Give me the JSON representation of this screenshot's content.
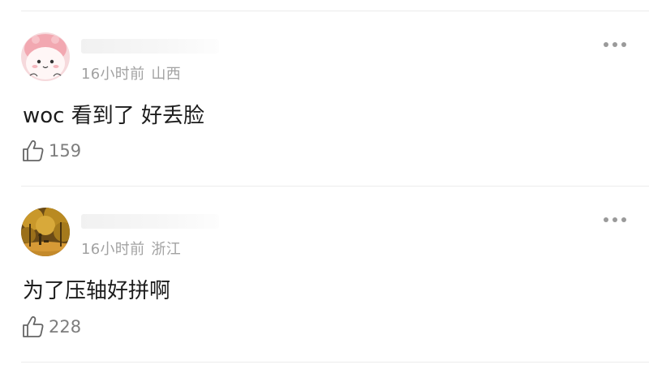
{
  "comments": [
    {
      "time": "16小时前",
      "location": "山西",
      "content": "woc 看到了 好丢脸",
      "likes": "159"
    },
    {
      "time": "16小时前",
      "location": "浙江",
      "content": "为了压轴好拼啊",
      "likes": "228"
    }
  ],
  "colors": {
    "meta_text": "#a2a2a2",
    "content_text": "#1c1c1c",
    "like_text": "#7d7d7d",
    "divider": "#ececec"
  },
  "icons": {
    "like": "thumbs-up-outline-icon",
    "more": "three-dots-icon"
  }
}
